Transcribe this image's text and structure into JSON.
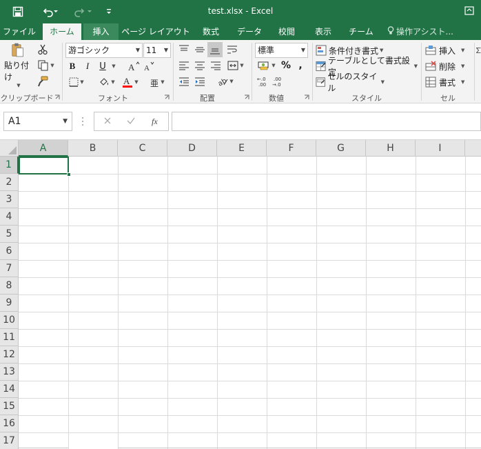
{
  "window": {
    "title": "test.xlsx - Excel"
  },
  "qat": {
    "icons": [
      "save-icon",
      "undo-icon",
      "redo-icon",
      "customize-qat-icon"
    ]
  },
  "tabs": [
    "ファイル",
    "ホーム",
    "挿入",
    "ページ レイアウト",
    "数式",
    "データ",
    "校閲",
    "表示",
    "チーム"
  ],
  "active_tab": "ホーム",
  "tell_me": "操作アシスト...",
  "ribbon": {
    "clipboard": {
      "paste_label": "貼り付け",
      "group_label": "クリップボード"
    },
    "font": {
      "font_name": "游ゴシック",
      "font_size": "11",
      "bold": "B",
      "italic": "I",
      "underline": "U",
      "group_label": "フォント"
    },
    "alignment": {
      "group_label": "配置"
    },
    "number": {
      "format": "標準",
      "percent": "%",
      "comma": ",",
      "group_label": "数値"
    },
    "styles": {
      "conditional": "条件付き書式",
      "table": "テーブルとして書式設定",
      "cell_styles": "セルのスタイル",
      "group_label": "スタイル"
    },
    "cells": {
      "insert": "挿入",
      "delete": "削除",
      "format": "書式",
      "group_label": "セル"
    }
  },
  "formula_bar": {
    "name_box": "A1",
    "formula": ""
  },
  "sheet": {
    "columns": [
      "A",
      "B",
      "C",
      "D",
      "E",
      "F",
      "G",
      "H",
      "I"
    ],
    "rows": [
      "1",
      "2",
      "3",
      "4",
      "5",
      "6",
      "7",
      "8",
      "9",
      "10",
      "11",
      "12",
      "13",
      "14",
      "15",
      "16",
      "17"
    ],
    "active_cell": "A1"
  },
  "colors": {
    "accent": "#217346",
    "ribbon_bg": "#f3f3f3",
    "header_bg": "#e6e6e6",
    "font_color_bar": "#ff0000"
  }
}
